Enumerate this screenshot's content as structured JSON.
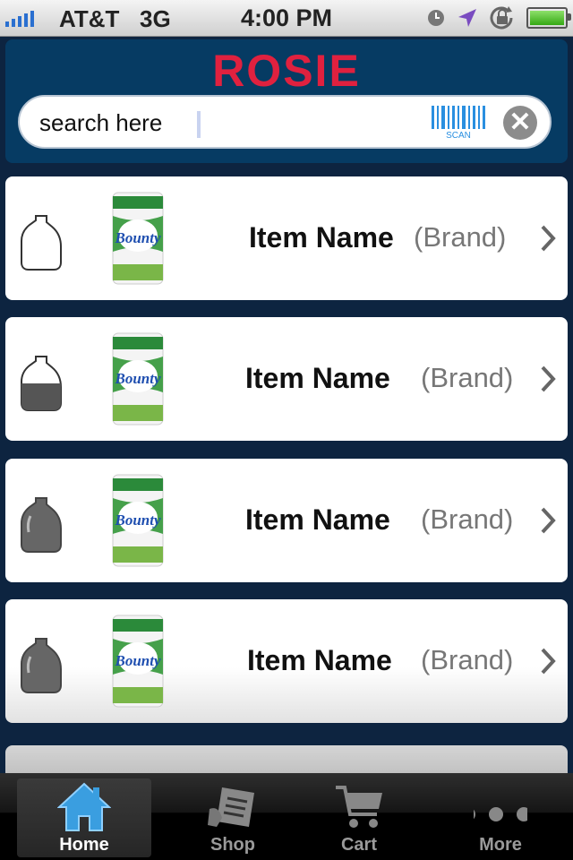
{
  "status_bar": {
    "carrier": "AT&T",
    "network": "3G",
    "time": "4:00 PM",
    "icons": [
      "signal-icon",
      "clock-icon",
      "location-icon",
      "rotation-lock-icon",
      "battery-icon"
    ]
  },
  "header": {
    "logo": "ROSIE",
    "search_placeholder": "search here",
    "scan_label": "SCAN",
    "clear_symbol": "✕"
  },
  "items": [
    {
      "name": "Item Name",
      "brand": "(Brand)",
      "jug_level": "empty"
    },
    {
      "name": "Item Name",
      "brand": "(Brand)",
      "jug_level": "half"
    },
    {
      "name": "Item Name",
      "brand": "(Brand)",
      "jug_level": "full"
    },
    {
      "name": "Item Name",
      "brand": "(Brand)",
      "jug_level": "full"
    }
  ],
  "tabs": [
    {
      "label": "Home",
      "icon": "home-icon",
      "active": true
    },
    {
      "label": "Shop",
      "icon": "shop-icon",
      "active": false
    },
    {
      "label": "Cart",
      "icon": "cart-icon",
      "active": false
    },
    {
      "label": "More",
      "icon": "more-icon",
      "active": false
    }
  ],
  "colors": {
    "background": "#0d2440",
    "header": "#063b63",
    "logo": "#e0213f",
    "scan": "#2a8fe0",
    "tab_active": "#3a9ee0"
  }
}
